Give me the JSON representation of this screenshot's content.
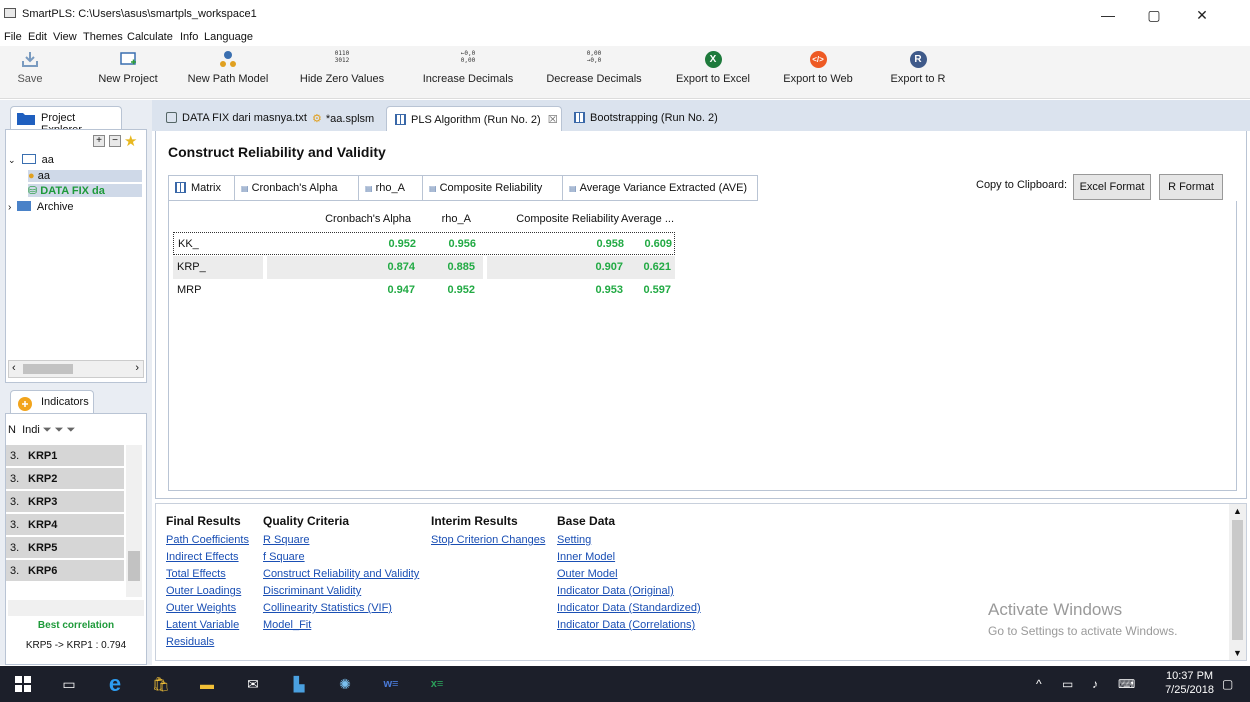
{
  "window": {
    "title": "SmartPLS: C:\\Users\\asus\\smartpls_workspace1",
    "min": "—",
    "max": "▢",
    "close": "✕"
  },
  "menu": [
    "File",
    "Edit",
    "View",
    "Themes",
    "Calculate",
    "Info",
    "Language"
  ],
  "toolbar": {
    "save": "Save",
    "new_project": "New Project",
    "new_path_model": "New Path Model",
    "hide_zero": "Hide Zero Values",
    "increase_dec": "Increase Decimals",
    "decrease_dec": "Decrease Decimals",
    "export_excel": "Export to Excel",
    "export_web": "Export to Web",
    "export_r": "Export to R",
    "hide_zero_icon_top": "0110",
    "hide_zero_icon_bottom": "3012",
    "inc_icon_top": "←0,0",
    "inc_icon_bottom": "0,00",
    "dec_icon_top": "0,00",
    "dec_icon_bottom": "→0,0",
    "excel_glyph": "X",
    "web_glyph": "</>",
    "r_glyph": "R"
  },
  "project_explorer": {
    "tab": "Project Explorer",
    "root": "aa",
    "child_model": "aa",
    "child_data": "DATA FIX da",
    "archive": "Archive"
  },
  "indicators": {
    "tab": "Indicators",
    "col_n": "N",
    "col_indi": "Indi",
    "rows": [
      {
        "n": "3.",
        "name": "KRP1"
      },
      {
        "n": "3.",
        "name": "KRP2"
      },
      {
        "n": "3.",
        "name": "KRP3"
      },
      {
        "n": "3.",
        "name": "KRP4"
      },
      {
        "n": "3.",
        "name": "KRP5"
      },
      {
        "n": "3.",
        "name": "KRP6"
      }
    ],
    "best_label": "Best correlation",
    "best_value": "KRP5 -> KRP1 : 0.794"
  },
  "editor_tabs": [
    {
      "label": "DATA FIX dari masnya.txt"
    },
    {
      "label": "*aa.splsm"
    },
    {
      "label": "PLS Algorithm (Run No. 2)",
      "close": "☒"
    },
    {
      "label": "Bootstrapping (Run No. 2)"
    }
  ],
  "main": {
    "title": "Construct Reliability and Validity",
    "subtabs": [
      "Matrix",
      "Cronbach's Alpha",
      "rho_A",
      "Composite Reliability",
      "Average Variance Extracted (AVE)"
    ],
    "copy_label": "Copy to Clipboard:",
    "excel_format": "Excel Format",
    "r_format": "R Format",
    "columns": [
      "Cronbach's Alpha",
      "rho_A",
      "Composite Reliability",
      "Average ..."
    ],
    "rows": [
      {
        "label": "KK_",
        "ca": "0.952",
        "rho": "0.956",
        "cr": "0.958",
        "ave": "0.609"
      },
      {
        "label": "KRP_",
        "ca": "0.874",
        "rho": "0.885",
        "cr": "0.907",
        "ave": "0.621"
      },
      {
        "label": "MRP",
        "ca": "0.947",
        "rho": "0.952",
        "cr": "0.953",
        "ave": "0.597"
      }
    ],
    "value_color": "#22aa44"
  },
  "results": {
    "final": {
      "title": "Final Results",
      "links": [
        "Path Coefficients",
        "Indirect Effects",
        "Total Effects",
        "Outer Loadings",
        "Outer Weights",
        "Latent Variable",
        "Residuals"
      ]
    },
    "quality": {
      "title": "Quality Criteria",
      "links": [
        "R Square",
        "f Square",
        "Construct Reliability and Validity",
        "Discriminant Validity",
        "Collinearity Statistics (VIF)",
        "Model_Fit"
      ]
    },
    "interim": {
      "title": "Interim Results",
      "links": [
        "Stop Criterion Changes"
      ]
    },
    "base": {
      "title": "Base Data",
      "links": [
        "Setting",
        "Inner Model",
        "Outer Model",
        "Indicator Data (Original)",
        "Indicator Data (Standardized)",
        "Indicator Data (Correlations)"
      ]
    }
  },
  "activate": {
    "line1": "Activate Windows",
    "line2": "Go to Settings to activate Windows."
  },
  "taskbar": {
    "time": "10:37 PM",
    "date": "7/25/2018",
    "excel_glyph": "x≡",
    "word_glyph": "w≡"
  }
}
